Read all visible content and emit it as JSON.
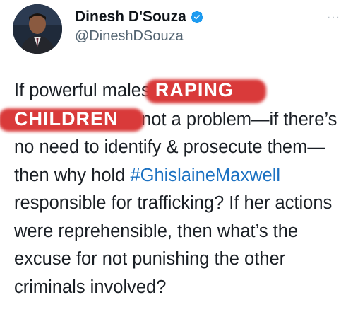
{
  "author": {
    "display_name": "Dinesh D'Souza",
    "handle": "@DineshDSouza",
    "verified_icon": "verified-badge-icon"
  },
  "more_label": "···",
  "tweet": {
    "text_1": "If powerful males",
    "redaction_1": "RAPING",
    "redaction_2": "CHILDREN",
    "text_2": "is not a problem—if there’s no need to identify & prosecute them—then why hold",
    "hashtag": "#GhislaineMaxwell",
    "text_3": "responsible for trafficking? If her actions were reprehensible, then what’s the excuse for not punishing the other criminals involved?"
  },
  "colors": {
    "hashtag": "#1d72c2",
    "verified": "#1d9bf0",
    "redaction": "#d93a3a"
  }
}
